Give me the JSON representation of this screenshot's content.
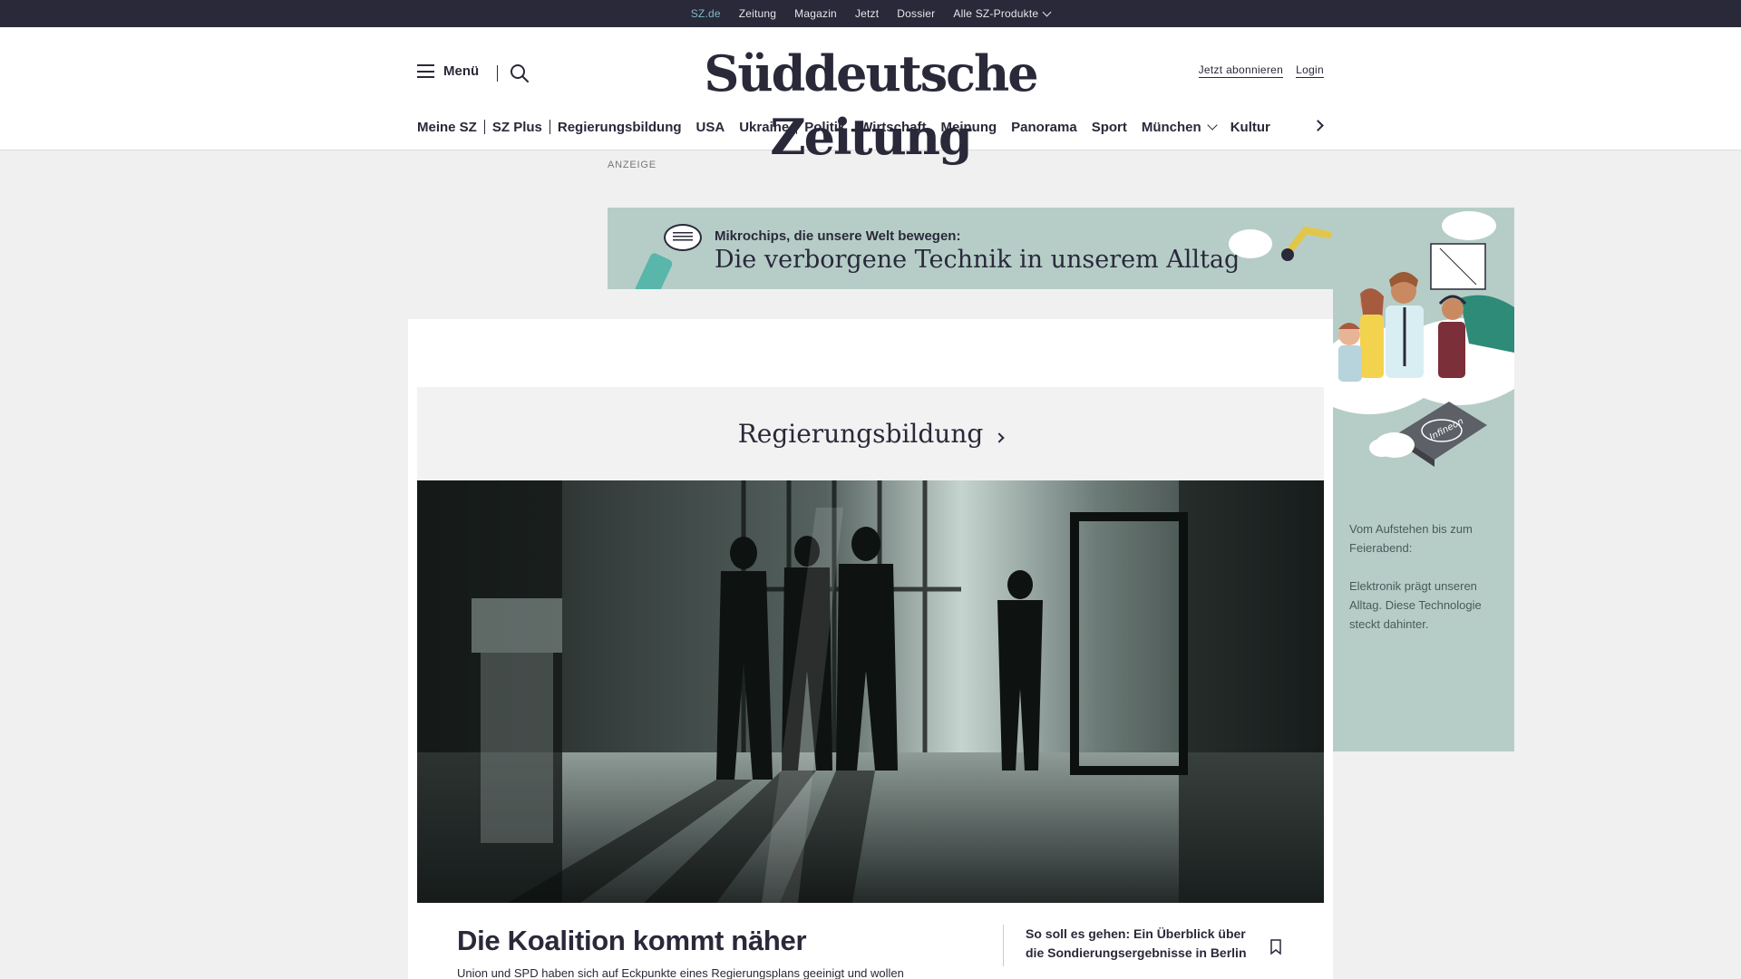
{
  "topbar": {
    "links": [
      "SZ.de",
      "Zeitung",
      "Magazin",
      "Jetzt",
      "Dossier",
      "Alle SZ-Produkte"
    ]
  },
  "header": {
    "menu_label": "Menü",
    "logo": "Süddeutsche Zeitung",
    "subscribe": "Jetzt abonnieren",
    "login": "Login"
  },
  "nav": {
    "items": [
      "Meine SZ",
      "SZ Plus",
      "Regierungsbildung",
      "USA",
      "Ukraine",
      "Politik",
      "Wirtschaft",
      "Meinung",
      "Panorama",
      "Sport",
      "München",
      "Kultur"
    ]
  },
  "ad": {
    "label": "ANZEIGE",
    "kicker": "Mikrochips, die unsere Welt bewegen:",
    "headline": "Die verborgene Technik in unserem Alltag",
    "side_text_1": "Vom Aufstehen bis zum Feierabend:",
    "side_text_2": "Elektronik prägt unseren Alltag. Diese Technologie steckt dahinter.",
    "chip_brand": "Infineon"
  },
  "main": {
    "topic": "Regierungsbildung",
    "headline": "Die Koalition kommt näher",
    "teaser": "Union und SPD haben sich auf Eckpunkte eines Regierungsplans geeinigt und wollen",
    "related": "So soll es gehen: Ein Überblick über die Sondierungsergebnisse in Berlin"
  },
  "colors": {
    "brand_dark": "#29293a",
    "accent": "#7fb8c6",
    "ad_background": "#b6cdc7"
  }
}
